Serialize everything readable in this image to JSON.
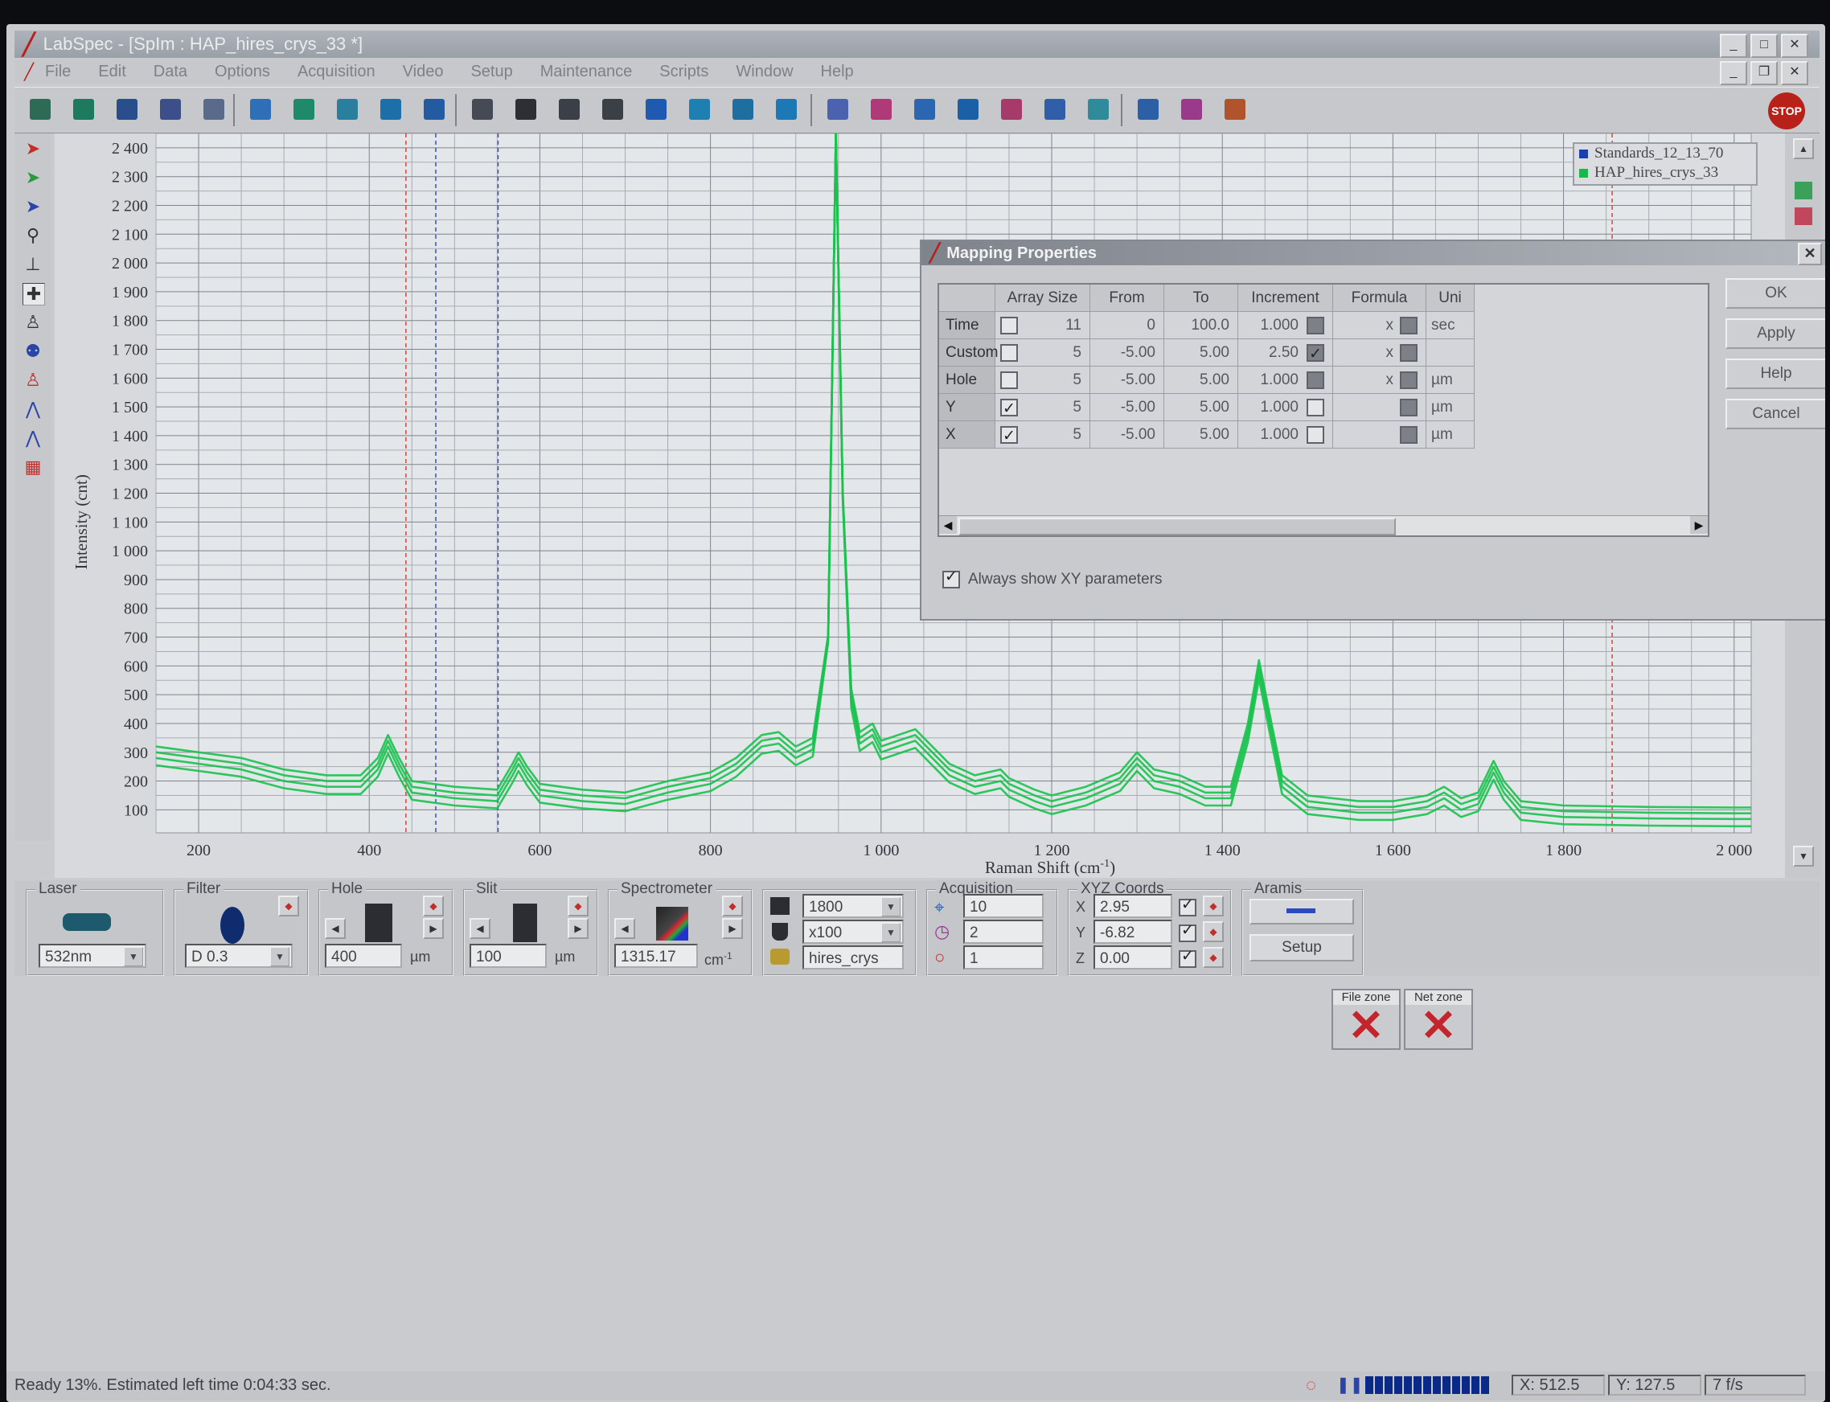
{
  "window": {
    "title": "LabSpec - [SpIm : HAP_hires_crys_33 *]"
  },
  "menu": [
    "File",
    "Edit",
    "Data",
    "Options",
    "Acquisition",
    "Video",
    "Setup",
    "Maintenance",
    "Scripts",
    "Window",
    "Help"
  ],
  "toolbar": {
    "stop_label": "STOP"
  },
  "chart_data": {
    "type": "line",
    "xlabel": "Raman Shift (cm",
    "xlabel_sup": "-1",
    "xlabel_end": ")",
    "ylabel": "Intensity (cnt)",
    "xlim": [
      150,
      2020
    ],
    "ylim": [
      20,
      2450
    ],
    "x_ticks": [
      {
        "v": 200,
        "label": "200"
      },
      {
        "v": 400,
        "label": "400"
      },
      {
        "v": 600,
        "label": "600"
      },
      {
        "v": 800,
        "label": "800"
      },
      {
        "v": 1000,
        "label": "1 000"
      },
      {
        "v": 1200,
        "label": "1 200"
      },
      {
        "v": 1400,
        "label": "1 400"
      },
      {
        "v": 1600,
        "label": "1 600"
      },
      {
        "v": 1800,
        "label": "1 800"
      },
      {
        "v": 2000,
        "label": "2 000"
      }
    ],
    "y_ticks": [
      {
        "v": 100,
        "label": "100"
      },
      {
        "v": 200,
        "label": "200"
      },
      {
        "v": 300,
        "label": "300"
      },
      {
        "v": 400,
        "label": "400"
      },
      {
        "v": 500,
        "label": "500"
      },
      {
        "v": 600,
        "label": "600"
      },
      {
        "v": 700,
        "label": "700"
      },
      {
        "v": 800,
        "label": "800"
      },
      {
        "v": 900,
        "label": "900"
      },
      {
        "v": 1000,
        "label": "1 000"
      },
      {
        "v": 1100,
        "label": "1 100"
      },
      {
        "v": 1200,
        "label": "1 200"
      },
      {
        "v": 1300,
        "label": "1 300"
      },
      {
        "v": 1400,
        "label": "1 400"
      },
      {
        "v": 1500,
        "label": "1 500"
      },
      {
        "v": 1600,
        "label": "1 600"
      },
      {
        "v": 1700,
        "label": "1 700"
      },
      {
        "v": 1800,
        "label": "1 800"
      },
      {
        "v": 1900,
        "label": "1 900"
      },
      {
        "v": 2000,
        "label": "2 000"
      },
      {
        "v": 2100,
        "label": "2 100"
      },
      {
        "v": 2200,
        "label": "2 200"
      },
      {
        "v": 2300,
        "label": "2 300"
      },
      {
        "v": 2400,
        "label": "2 400"
      }
    ],
    "grid": true,
    "markers_red_x": [
      443,
      1857
    ],
    "markers_blue_x": [
      478,
      551
    ],
    "legend": [
      {
        "name": "Standards_12_13_70",
        "color": "#1a3fb0"
      },
      {
        "name": "HAP_hires_crys_33",
        "color": "#18b84a"
      }
    ],
    "series": [
      {
        "name": "HAP_hires_crys_33",
        "color": "#18c24e",
        "points": [
          [
            150,
            300
          ],
          [
            200,
            280
          ],
          [
            250,
            260
          ],
          [
            300,
            220
          ],
          [
            350,
            200
          ],
          [
            390,
            200
          ],
          [
            410,
            260
          ],
          [
            422,
            340
          ],
          [
            435,
            260
          ],
          [
            450,
            180
          ],
          [
            500,
            160
          ],
          [
            550,
            150
          ],
          [
            568,
            240
          ],
          [
            575,
            280
          ],
          [
            585,
            230
          ],
          [
            600,
            170
          ],
          [
            650,
            150
          ],
          [
            700,
            140
          ],
          [
            750,
            180
          ],
          [
            800,
            210
          ],
          [
            830,
            260
          ],
          [
            860,
            340
          ],
          [
            880,
            350
          ],
          [
            900,
            300
          ],
          [
            920,
            330
          ],
          [
            938,
            700
          ],
          [
            947,
            2500
          ],
          [
            955,
            1200
          ],
          [
            965,
            500
          ],
          [
            975,
            350
          ],
          [
            990,
            380
          ],
          [
            1000,
            320
          ],
          [
            1020,
            340
          ],
          [
            1040,
            360
          ],
          [
            1060,
            300
          ],
          [
            1080,
            240
          ],
          [
            1110,
            200
          ],
          [
            1140,
            220
          ],
          [
            1150,
            190
          ],
          [
            1180,
            150
          ],
          [
            1200,
            130
          ],
          [
            1240,
            160
          ],
          [
            1280,
            210
          ],
          [
            1300,
            280
          ],
          [
            1320,
            220
          ],
          [
            1350,
            200
          ],
          [
            1380,
            160
          ],
          [
            1410,
            160
          ],
          [
            1430,
            380
          ],
          [
            1443,
            600
          ],
          [
            1455,
            420
          ],
          [
            1470,
            200
          ],
          [
            1500,
            130
          ],
          [
            1560,
            110
          ],
          [
            1600,
            110
          ],
          [
            1640,
            130
          ],
          [
            1660,
            160
          ],
          [
            1680,
            120
          ],
          [
            1700,
            140
          ],
          [
            1718,
            250
          ],
          [
            1730,
            180
          ],
          [
            1750,
            110
          ],
          [
            1800,
            95
          ],
          [
            1900,
            90
          ],
          [
            2000,
            88
          ],
          [
            2020,
            88
          ]
        ],
        "offsets": [
          0,
          -20,
          20,
          -45
        ]
      }
    ]
  },
  "overlay": {
    "file_zone": "File zone",
    "net_zone": "Net zone"
  },
  "dialog": {
    "title": "Mapping Properties",
    "columns": [
      "Array Size",
      "From",
      "To",
      "Increment",
      "Formula",
      "Uni"
    ],
    "rows": [
      {
        "name": "Time",
        "checked": false,
        "size": "11",
        "from": "0",
        "to": "100.0",
        "inc": "1.000",
        "inc_cb": false,
        "formula_x": "x",
        "unit": "sec"
      },
      {
        "name": "Custom",
        "checked": false,
        "size": "5",
        "from": "-5.00",
        "to": "5.00",
        "inc": "2.50",
        "inc_cb": true,
        "formula_x": "x",
        "unit": ""
      },
      {
        "name": "Hole",
        "checked": false,
        "size": "5",
        "from": "-5.00",
        "to": "5.00",
        "inc": "1.000",
        "inc_cb": false,
        "formula_x": "x",
        "unit": "µm"
      },
      {
        "name": "Y",
        "checked": true,
        "size": "5",
        "from": "-5.00",
        "to": "5.00",
        "inc": "1.000",
        "inc_cb": false,
        "formula_x": "",
        "unit": "µm"
      },
      {
        "name": "X",
        "checked": true,
        "size": "5",
        "from": "-5.00",
        "to": "5.00",
        "inc": "1.000",
        "inc_cb": false,
        "formula_x": "",
        "unit": "µm"
      }
    ],
    "buttons": {
      "ok": "OK",
      "apply": "Apply",
      "help": "Help",
      "cancel": "Cancel"
    },
    "always_show": "Always show XY parameters"
  },
  "panel": {
    "laser": {
      "label": "Laser",
      "value": "532nm"
    },
    "filter": {
      "label": "Filter",
      "value": "D 0.3"
    },
    "hole": {
      "label": "Hole",
      "value": "400",
      "unit": "µm"
    },
    "slit": {
      "label": "Slit",
      "value": "100",
      "unit": "µm"
    },
    "spectrometer": {
      "label": "Spectrometer",
      "value": "1315.17",
      "unit": "cm",
      "unit_sup": "-1"
    },
    "grating": {
      "value": "1800"
    },
    "objective": {
      "value": "x100"
    },
    "filename": {
      "value": "hires_crys"
    },
    "acquisition": {
      "label": "Acquisition",
      "time": "10",
      "accum": "2",
      "count": "1"
    },
    "xyz": {
      "label": "XYZ Coords",
      "x_label": "X",
      "y_label": "Y",
      "z_label": "Z",
      "x": "2.95",
      "y": "-6.82",
      "z": "0.00"
    },
    "aramis": {
      "label": "Aramis",
      "setup": "Setup"
    }
  },
  "status": {
    "text": "Ready 13%. Estimated left time 0:04:33 sec.",
    "progress": 0.13,
    "x": "X: 512.5",
    "y": "Y: 127.5",
    "fps": "7 f/s"
  }
}
